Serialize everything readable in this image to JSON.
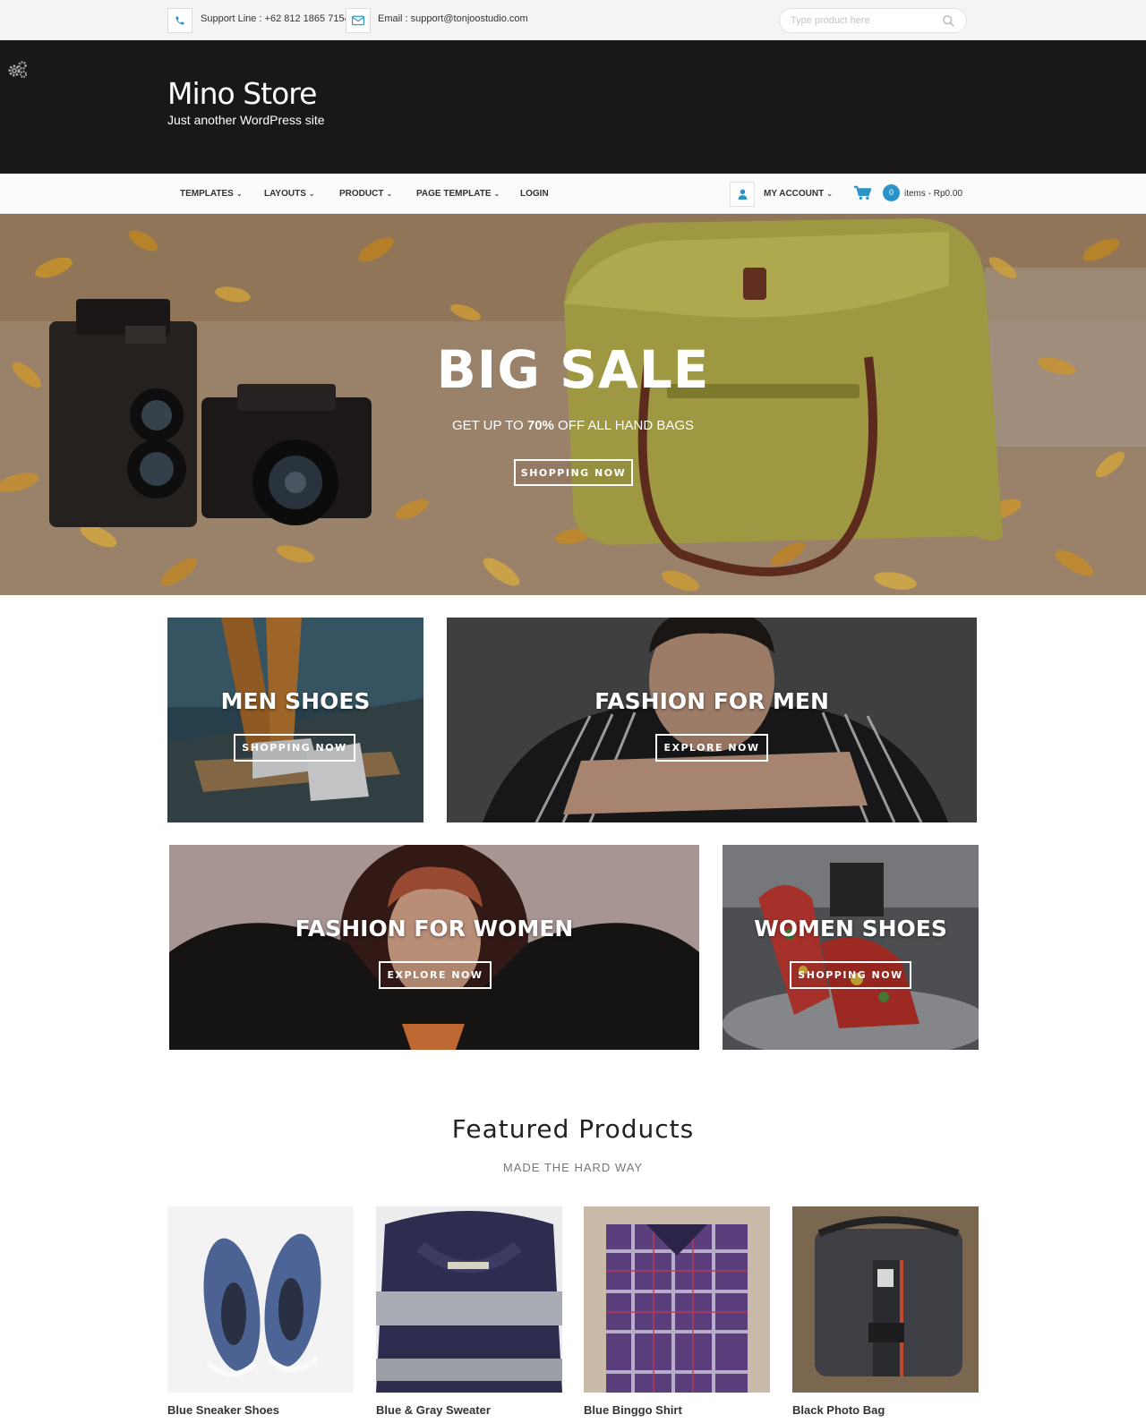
{
  "topbar": {
    "support_text": "Support Line : +62 812 1865 7154",
    "email_text": "Email : support@tonjoostudio.com",
    "search_placeholder": "Type product here"
  },
  "header": {
    "site_title": "Mino Store",
    "site_description": "Just another WordPress site"
  },
  "nav": {
    "items": [
      {
        "label": "TEMPLATES",
        "has_dropdown": true
      },
      {
        "label": "LAYOUTS",
        "has_dropdown": true
      },
      {
        "label": "PRODUCT",
        "has_dropdown": true
      },
      {
        "label": "PAGE TEMPLATE",
        "has_dropdown": true
      },
      {
        "label": "LOGIN",
        "has_dropdown": false
      }
    ],
    "account_label": "MY ACCOUNT",
    "cart_count": "0",
    "cart_text": "items - Rp0.00"
  },
  "hero": {
    "title": "BIG SALE",
    "subtitle_prefix": "GET UP TO ",
    "subtitle_highlight": "70%",
    "subtitle_suffix": " OFF ALL HAND BAGS",
    "button": "SHOPPING NOW"
  },
  "categories": [
    {
      "title": "MEN SHOES",
      "button": "SHOPPING NOW"
    },
    {
      "title": "FASHION FOR MEN",
      "button": "EXPLORE NOW"
    },
    {
      "title": "FASHION FOR WOMEN",
      "button": "EXPLORE NOW"
    },
    {
      "title": "WOMEN SHOES",
      "button": "SHOPPING NOW"
    }
  ],
  "featured": {
    "title": "Featured Products",
    "subtitle": "MADE THE HARD WAY",
    "products": [
      {
        "name": "Blue Sneaker Shoes"
      },
      {
        "name": "Blue & Gray Sweater"
      },
      {
        "name": "Blue Binggo Shirt"
      },
      {
        "name": "Black Photo Bag"
      }
    ]
  },
  "colors": {
    "header_bg": "#1a1718",
    "accent_blue": "#2b93c7",
    "topbar_bg": "#f4f4f4"
  },
  "icons": [
    "phone-icon",
    "email-icon",
    "search-icon",
    "gear-icon",
    "user-icon",
    "cart-icon",
    "chevron-down-icon"
  ]
}
